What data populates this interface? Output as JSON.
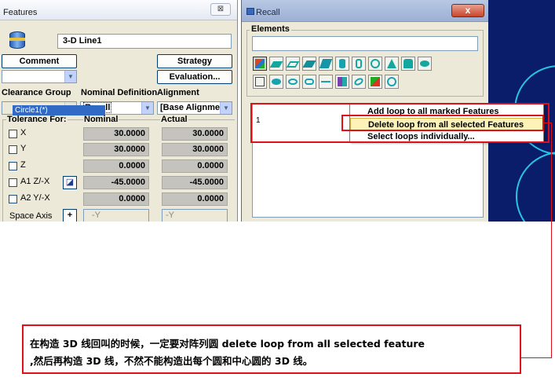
{
  "features_window": {
    "title": "Features",
    "close_label": "⊠",
    "feature_name": "3-D Line1",
    "comment_label": "Comment",
    "strategy_label": "Strategy",
    "evaluation_label": "Evaluation...",
    "clearance_group_label": "Clearance Group",
    "nominal_definition_label": "Nominal Definition",
    "alignment_label": "Alignment",
    "nominal_definition_value": "Recall",
    "alignment_value": "[Base Alignme",
    "tolerance_label": "Tolerance For:",
    "nominal_label": "Nominal",
    "actual_label": "Actual",
    "rows": [
      {
        "axis": "X",
        "nominal": "30.0000",
        "actual": "30.0000"
      },
      {
        "axis": "Y",
        "nominal": "30.0000",
        "actual": "30.0000"
      },
      {
        "axis": "Z",
        "nominal": "0.0000",
        "actual": "0.0000"
      },
      {
        "axis": "A1 Z/-X",
        "nominal": "-45.0000",
        "actual": "-45.0000"
      },
      {
        "axis": "A2 Y/-X",
        "nominal": "0.0000",
        "actual": "0.0000"
      }
    ],
    "space_axis_label": "Space Axis",
    "space_axis_button": "+",
    "space_axis_nominal": "-Y",
    "space_axis_actual": "-Y"
  },
  "recall_window": {
    "title": "Recall",
    "close_label": "x",
    "elements_label": "Elements",
    "list_items": [
      "Circle1(*)",
      "1"
    ]
  },
  "context_menu": {
    "items": [
      "Add loop to all marked Features",
      "Delete loop from all selected Features",
      "Select loops individually..."
    ]
  },
  "annotation": {
    "line1": "在构造 3D 线回叫的时候，一定要对阵列圆 delete loop from all selected feature",
    "line2": ",然后再构造 3D 线，不然不能构造出每个圆和中心圆的 3D 线。"
  },
  "colors": {
    "highlight": "#e0101a",
    "selection": "#316ac5",
    "menu_hover": "#fdf3b8"
  }
}
